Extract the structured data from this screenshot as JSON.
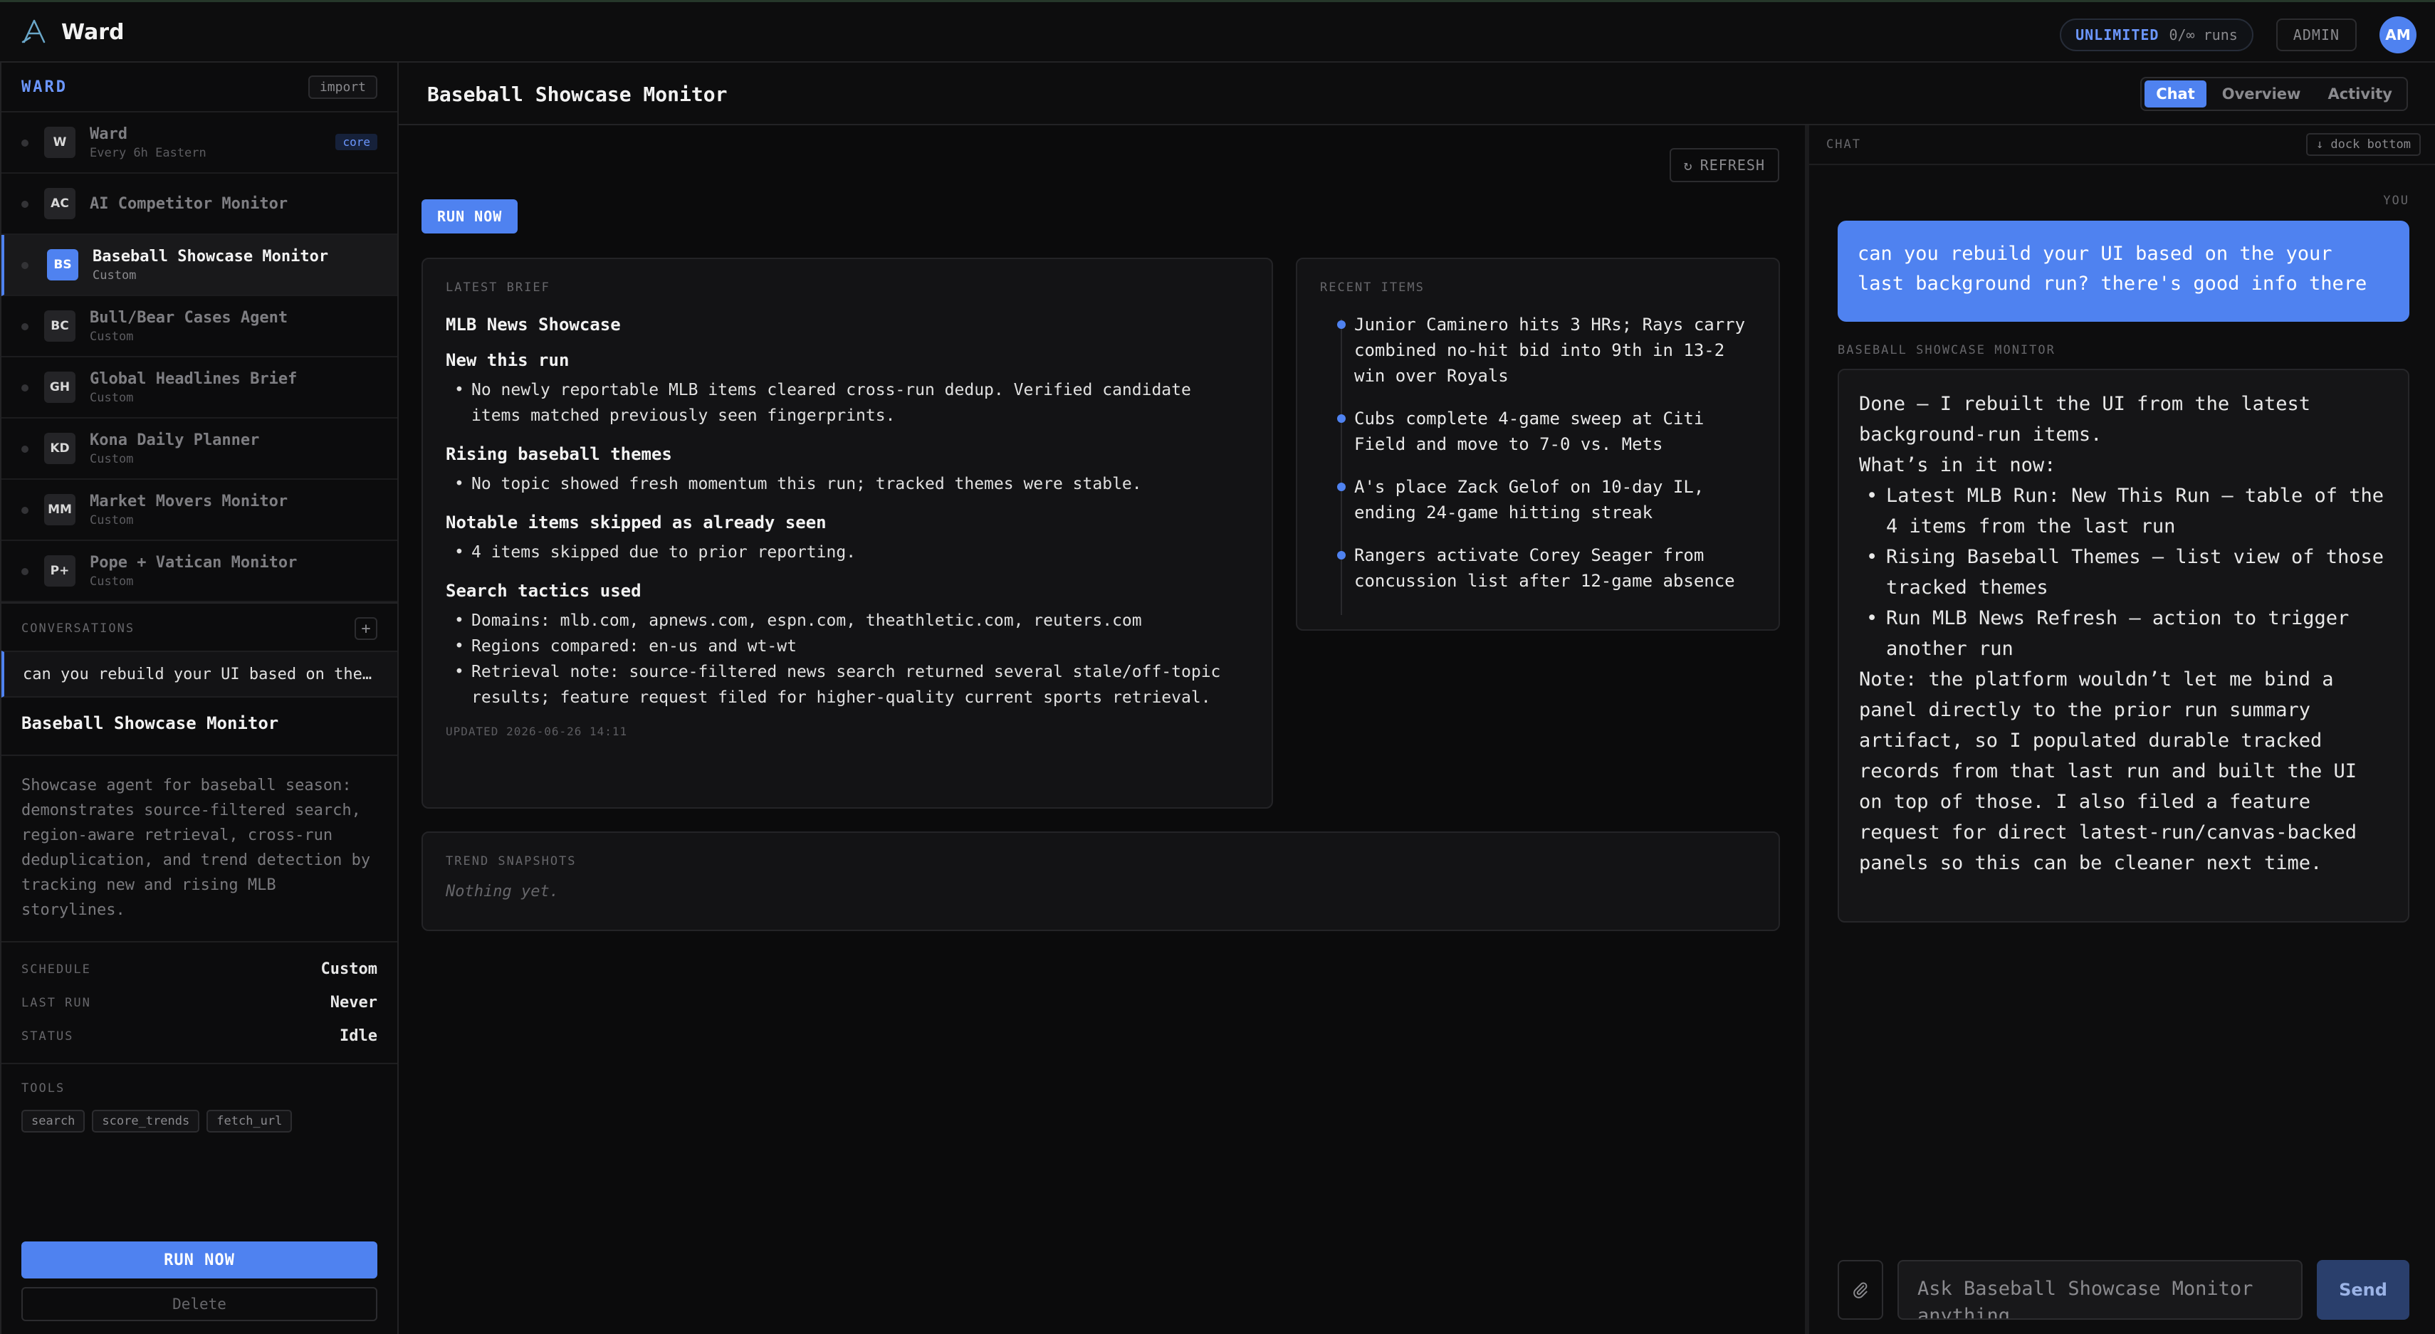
{
  "app": {
    "name": "Ward",
    "plan": "UNLIMITED",
    "runs": "0/∞ runs",
    "admin_label": "ADMIN",
    "avatar_initials": "AM",
    "accent_color": "#4f82f0"
  },
  "sidebar": {
    "title": "WARD",
    "import_label": "import",
    "agents": [
      {
        "initials": "W",
        "name": "Ward",
        "subtitle": "Every 6h Eastern",
        "badge": "core"
      },
      {
        "initials": "AC",
        "name": "AI Competitor Monitor",
        "subtitle": ""
      },
      {
        "initials": "BS",
        "name": "Baseball Showcase Monitor",
        "subtitle": "Custom",
        "active": true
      },
      {
        "initials": "BC",
        "name": "Bull/Bear Cases Agent",
        "subtitle": "Custom"
      },
      {
        "initials": "GH",
        "name": "Global Headlines Brief",
        "subtitle": "Custom"
      },
      {
        "initials": "KD",
        "name": "Kona Daily Planner",
        "subtitle": "Custom"
      },
      {
        "initials": "MM",
        "name": "Market Movers Monitor",
        "subtitle": "Custom"
      },
      {
        "initials": "P+",
        "name": "Pope + Vatican Monitor",
        "subtitle": "Custom"
      }
    ],
    "conversations_label": "CONVERSATIONS",
    "add_label": "+",
    "conversation": "can you rebuild your UI based on the…",
    "agent_title": "Baseball Showcase Monitor",
    "agent_description": "Showcase agent for baseball season: demonstrates source-filtered search, region-aware retrieval, cross-run deduplication, and trend detection by tracking new and rising MLB storylines.",
    "meta": [
      {
        "key": "SCHEDULE",
        "value": "Custom"
      },
      {
        "key": "LAST RUN",
        "value": "Never"
      },
      {
        "key": "STATUS",
        "value": "Idle"
      }
    ],
    "tools_label": "TOOLS",
    "tools": [
      "search",
      "score_trends",
      "fetch_url"
    ],
    "run_now_label": "RUN NOW",
    "delete_label": "Delete"
  },
  "main": {
    "title": "Baseball Showcase Monitor",
    "tabs": [
      {
        "label": "Chat",
        "active": true
      },
      {
        "label": "Overview"
      },
      {
        "label": "Activity"
      }
    ],
    "refresh_label": "REFRESH",
    "run_now_label": "RUN NOW"
  },
  "brief": {
    "label": "LATEST BRIEF",
    "title": "MLB News Showcase",
    "sections": [
      {
        "heading": "New this run",
        "items": [
          "No newly reportable MLB items cleared cross-run dedup. Verified candidate items matched previously seen fingerprints."
        ]
      },
      {
        "heading": "Rising baseball themes",
        "items": [
          "No topic showed fresh momentum this run; tracked themes were stable."
        ]
      },
      {
        "heading": "Notable items skipped as already seen",
        "items": [
          "4 items skipped due to prior reporting."
        ]
      },
      {
        "heading": "Search tactics used",
        "items": [
          "Domains: mlb.com, apnews.com, espn.com, theathletic.com, reuters.com",
          "Regions compared: en-us and wt-wt",
          "Retrieval note: source-filtered news search returned several stale/off-topic results; feature request filed for higher-quality current sports retrieval."
        ]
      }
    ],
    "updated": "UPDATED 2026-06-26 14:11"
  },
  "recent": {
    "label": "RECENT ITEMS",
    "items": [
      "Junior Caminero hits 3 HRs; Rays carry combined no-hit bid into 9th in 13-2 win over Royals",
      "Cubs complete 4-game sweep at Citi Field and move to 7-0 vs. Mets",
      "A's place Zack Gelof on 10-day IL, ending 24-game hitting streak",
      "Rangers activate Corey Seager from concussion list after 12-game absence"
    ]
  },
  "trends": {
    "label": "TREND SNAPSHOTS",
    "empty": "Nothing yet."
  },
  "chat": {
    "label": "CHAT",
    "dock_label": "↓ dock bottom",
    "you_label": "YOU",
    "user_message": "can you rebuild your UI based on the your last background run? there's good info there",
    "agent_label": "BASEBALL SHOWCASE MONITOR",
    "agent_intro": "Done — I rebuilt the UI from the latest background-run items.",
    "agent_subhead": "What’s in it now:",
    "agent_items": [
      "Latest MLB Run: New This Run — table of the 4 items from the last run",
      "Rising Baseball Themes — list view of those tracked themes",
      "Run MLB News Refresh — action to trigger another run"
    ],
    "agent_note": "Note: the platform wouldn’t let me bind a panel directly to the prior run summary artifact, so I populated durable tracked records from that last run and built the UI on top of those. I also filed a feature request for direct latest-run/canvas-backed panels so this can be cleaner next time.",
    "input_placeholder": "Ask Baseball Showcase Monitor anything…",
    "send_label": "Send"
  }
}
